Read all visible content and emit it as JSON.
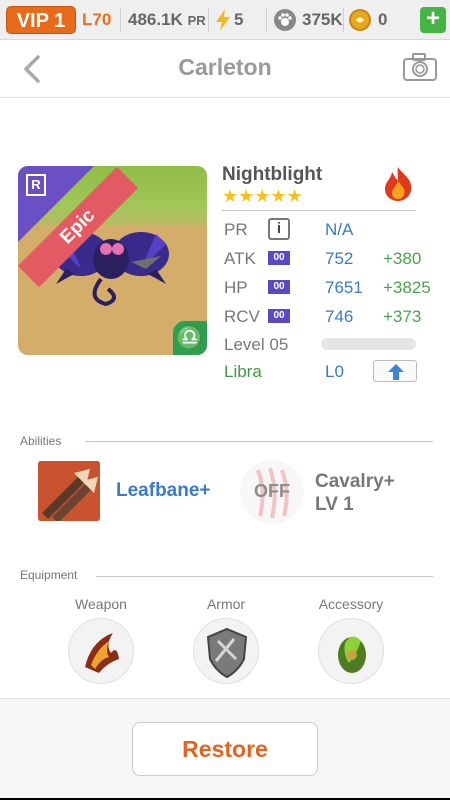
{
  "status_bar": {
    "vip": "VIP 1",
    "level": "L70",
    "pr_value": "486.1K",
    "pr_unit": "PR",
    "energy": "5",
    "paws": "375K",
    "coins": "0",
    "add_label": "+"
  },
  "nav": {
    "title": "Carleton",
    "back_icon": "chevron-left-icon",
    "camera_icon": "camera-icon"
  },
  "card": {
    "rarity_letter": "R",
    "rarity": "Epic",
    "sign_glyph": "♎"
  },
  "monster": {
    "name": "Nightblight",
    "stars": "★★★★★",
    "element_icon": "fire-icon",
    "pr_label": "PR",
    "pr_info": "i",
    "pr_value": "N/A",
    "boost_tag": "00",
    "stats": [
      {
        "label": "ATK",
        "value": "752",
        "bonus": "+380"
      },
      {
        "label": "HP",
        "value": "7651",
        "bonus": "+3825"
      },
      {
        "label": "RCV",
        "value": "746",
        "bonus": "+373"
      }
    ],
    "level_label": "Level 05",
    "level_progress": 0.0,
    "sign": "Libra",
    "sign_level": "L0"
  },
  "abilities": {
    "header": "Abilities",
    "items": [
      {
        "name": "Leafbane+"
      },
      {
        "status": "OFF",
        "name_line1": "Cavalry+",
        "name_line2": "LV 1"
      }
    ]
  },
  "equipment": {
    "header": "Equipment",
    "slots": [
      {
        "label": "Weapon"
      },
      {
        "label": "Armor"
      },
      {
        "label": "Accessory"
      }
    ]
  },
  "footer": {
    "restore_label": "Restore"
  },
  "colors": {
    "accent": "#e06520",
    "link_blue": "#3a7ac9",
    "bonus_green": "#4da14d",
    "epic_red": "#e45a63",
    "rarity_purple": "#6b4fc5"
  }
}
